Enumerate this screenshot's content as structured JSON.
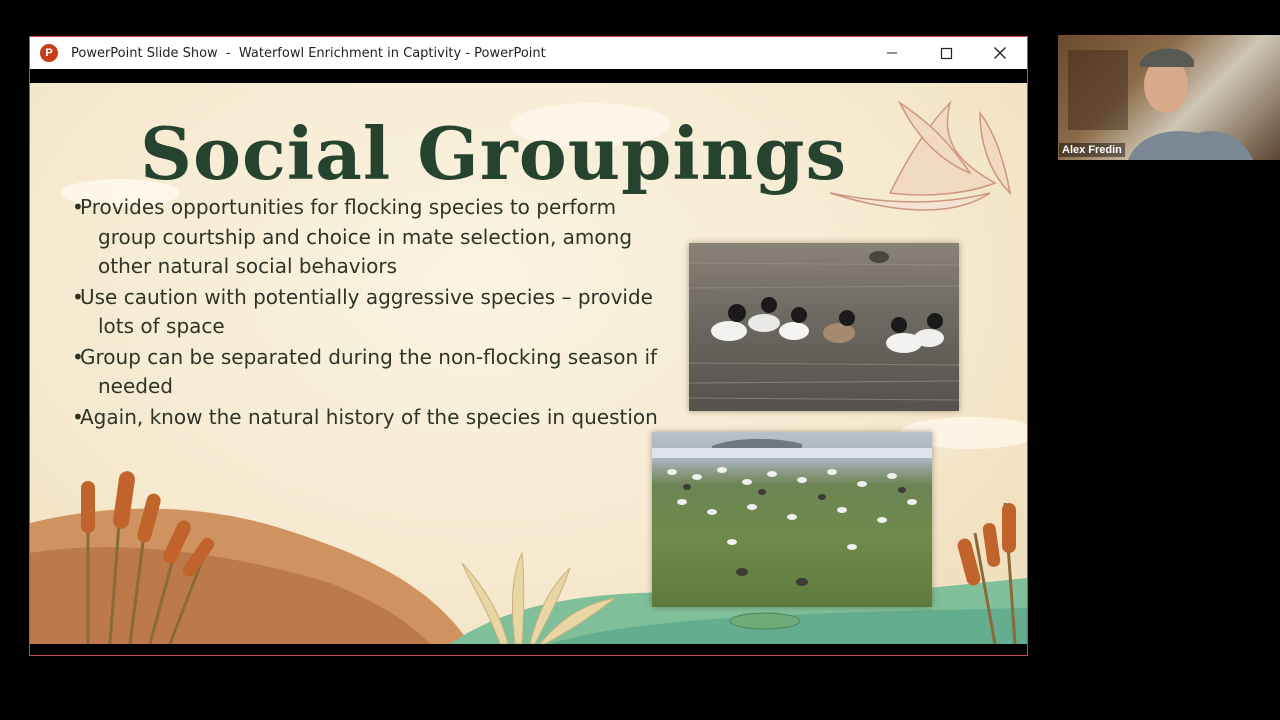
{
  "window": {
    "app_icon_letter": "P",
    "title": "PowerPoint Slide Show  -  Waterfowl Enrichment in Captivity - PowerPoint",
    "controls": {
      "minimize": "minimize-icon",
      "maximize": "maximize-icon",
      "close": "close-icon"
    }
  },
  "slide": {
    "title": "Social Groupings",
    "bullets": [
      {
        "marker": "•",
        "text": "Provides opportunities for flocking species to perform group courtship and choice in mate selection, among other natural social behaviors"
      },
      {
        "marker": "•",
        "text": "Use caution with potentially aggressive species – provide lots of space"
      },
      {
        "marker": "•",
        "text": "Group can be separated during the non-flocking season if needed"
      },
      {
        "marker": "•",
        "text": "Again, know the natural history of the species in question"
      }
    ],
    "colors": {
      "title": "#26432f",
      "text": "#2e3526",
      "background": "#f6ead0"
    }
  },
  "webcam": {
    "participant_name": "Alex Fredin"
  }
}
